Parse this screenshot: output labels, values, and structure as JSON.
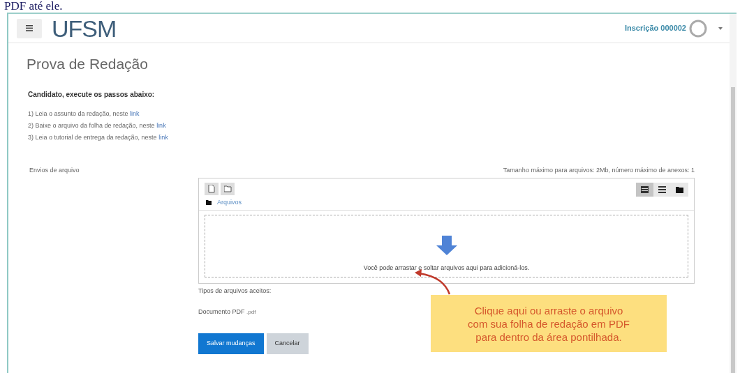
{
  "document_text": "PDF até ele.",
  "navbar": {
    "logo": "UFSM",
    "user": "Inscrição 000002"
  },
  "page": {
    "title": "Prova de Redação",
    "heading": "Candidato, execute os passos abaixo:",
    "steps": [
      {
        "text": "1) Leia o assunto da redação, neste ",
        "link": "link"
      },
      {
        "text": "2) Baixe o arquivo da folha de redação, neste ",
        "link": "link"
      },
      {
        "text": "3) Leia o tutorial de entrega da redação, neste ",
        "link": "link"
      }
    ]
  },
  "form": {
    "label": "Envios de arquivo",
    "limits": "Tamanho máximo para arquivos: 2Mb, número máximo de anexos: 1",
    "breadcrumb": "Arquivos",
    "tools": [
      {
        "kind": "file"
      },
      {
        "kind": "folder"
      }
    ],
    "views": [
      {
        "kind": "icons",
        "selected": true
      },
      {
        "kind": "list",
        "selected": false
      },
      {
        "kind": "tree",
        "selected": false
      }
    ],
    "drop_hint": "Você pode arrastar e soltar arquivos aqui para adicioná-los.",
    "accepted_label": "Tipos de arquivos aceitos:",
    "accepted_types": [
      {
        "name": "Documento PDF",
        "extension": ".pdf"
      }
    ],
    "buttons": [
      {
        "label": "Salvar mudanças",
        "kind": "primary"
      },
      {
        "label": "Cancelar",
        "kind": "secondary"
      }
    ]
  },
  "callout": {
    "lines": [
      "Clique aqui ou arraste o arquivo",
      "com sua folha de redação em PDF",
      "para dentro da área pontilhada."
    ]
  }
}
